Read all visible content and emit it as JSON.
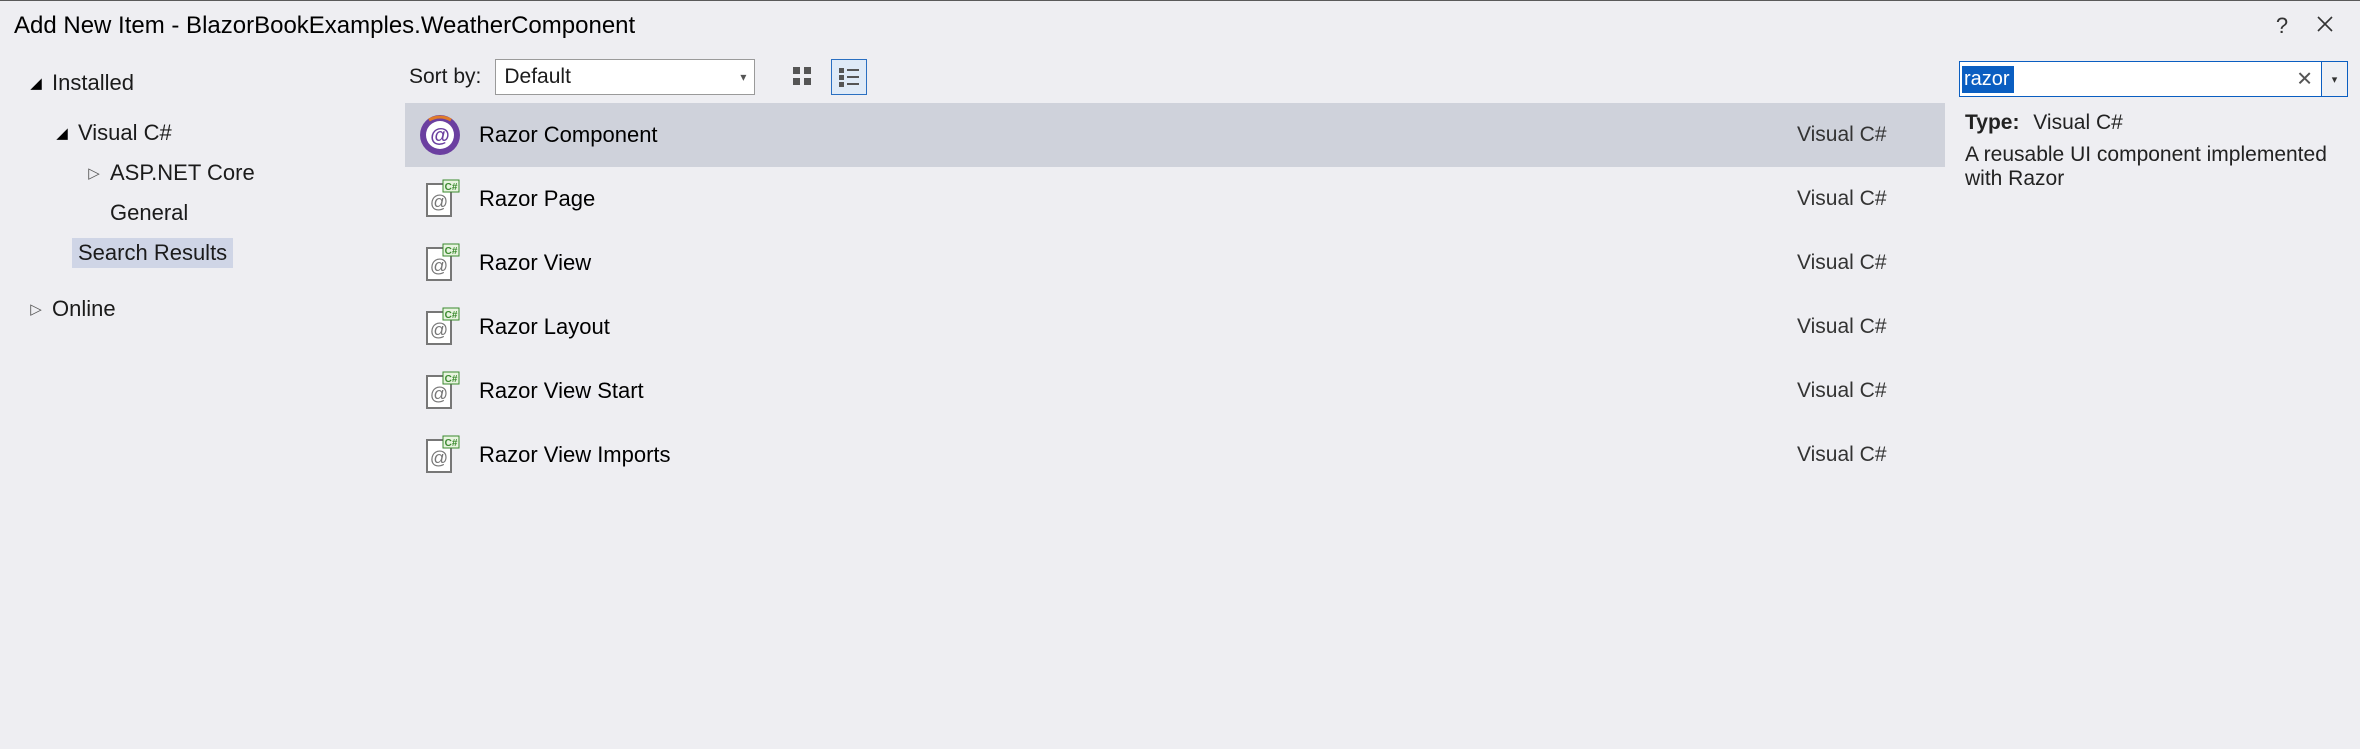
{
  "title": "Add New Item - BlazorBookExamples.WeatherComponent",
  "sidebar": {
    "installed": "Installed",
    "vcs": "Visual C#",
    "aspnet": "ASP.NET Core",
    "general": "General",
    "searchResults": "Search Results",
    "online": "Online"
  },
  "toolbar": {
    "sortLabel": "Sort by:",
    "sortValue": "Default"
  },
  "items": [
    {
      "name": "Razor Component",
      "lang": "Visual C#"
    },
    {
      "name": "Razor Page",
      "lang": "Visual C#"
    },
    {
      "name": "Razor View",
      "lang": "Visual C#"
    },
    {
      "name": "Razor Layout",
      "lang": "Visual C#"
    },
    {
      "name": "Razor View Start",
      "lang": "Visual C#"
    },
    {
      "name": "Razor View Imports",
      "lang": "Visual C#"
    }
  ],
  "search": {
    "value": "razor"
  },
  "details": {
    "typeLabel": "Type:",
    "typeValue": "Visual C#",
    "description": "A reusable UI component implemented with Razor"
  }
}
